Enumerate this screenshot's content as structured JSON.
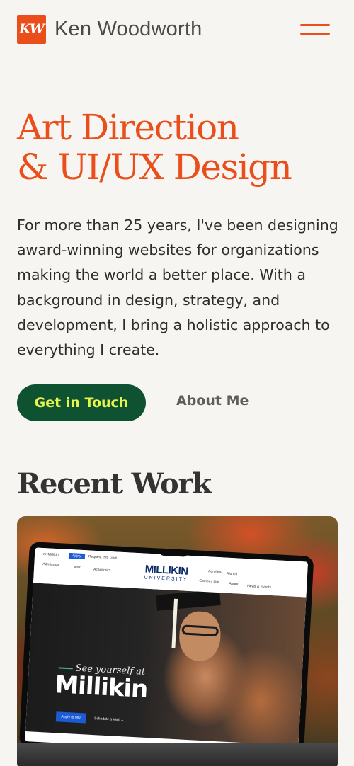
{
  "header": {
    "logo_text": "KW",
    "site_name": "Ken Woodworth",
    "menu_icon": "hamburger-menu-icon"
  },
  "hero": {
    "title_line1": "Art Direction",
    "title_line2": "& UI/UX Design",
    "description": "For more than 25 years, I've been designing award-winning websites for organizations making the world a better place. With a background in design, strategy, and development, I bring a holistic approach to everything I create.",
    "primary_cta": "Get in Touch",
    "secondary_cta": "About Me"
  },
  "recent_work": {
    "title": "Recent Work",
    "project": {
      "topbar": {
        "mymillikin": "myMillikin",
        "apply": "Apply",
        "request_info": "Request Info",
        "give": "Give",
        "admission": "Admission",
        "visit": "Visit",
        "academics": "Academics",
        "admitted": "Admitted",
        "alumni": "Alumni",
        "campus_life": "Campus Life",
        "about": "About",
        "news_events": "News & Events",
        "logo_top": "MILLIKIN",
        "logo_bottom": "UNIVERSITY"
      },
      "tagline": "See yourself at",
      "headline": "Millikin",
      "apply_btn": "Apply to MU",
      "schedule_link": "Schedule a Visit →"
    }
  },
  "colors": {
    "accent": "#e94e1b",
    "primary_button_bg": "#0e5232",
    "primary_button_text": "#e9f44a",
    "background": "#f6f5f2"
  }
}
